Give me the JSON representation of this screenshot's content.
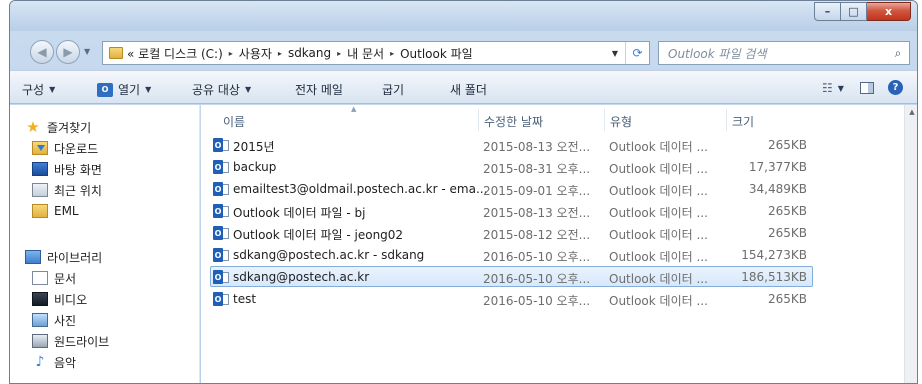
{
  "window": {
    "caption": {
      "min": "–",
      "max": "□",
      "close": "x"
    }
  },
  "nav": {
    "back_icon": "◀",
    "forward_icon": "▶",
    "history_icon": "▼"
  },
  "address": {
    "crumbs": [
      "« 로컬 디스크 (C:)",
      "사용자",
      "sdkang",
      "내 문서",
      "Outlook 파일"
    ],
    "separator": "▸",
    "dropdown_icon": "▼",
    "refresh_icon": "⟳"
  },
  "search": {
    "placeholder": "Outlook 파일 검색",
    "icon": "⌕"
  },
  "toolbar": {
    "organize": "구성",
    "open": "열기",
    "open_icon_text": "O",
    "share": "공유 대상",
    "email": "전자 메일",
    "burn": "굽기",
    "new_folder": "새 폴더",
    "caret": "▼",
    "view_icon": "☷",
    "help": "?"
  },
  "sidebar": {
    "favorites": {
      "label": "즐겨찾기",
      "items": [
        {
          "label": "다운로드",
          "icon": "downloads-folder-icon"
        },
        {
          "label": "바탕 화면",
          "icon": "desktop-icon"
        },
        {
          "label": "최근 위치",
          "icon": "recent-places-icon"
        },
        {
          "label": "EML",
          "icon": "folder-icon"
        }
      ]
    },
    "libraries": {
      "label": "라이브러리",
      "items": [
        {
          "label": "문서",
          "icon": "documents-icon"
        },
        {
          "label": "비디오",
          "icon": "videos-icon"
        },
        {
          "label": "사진",
          "icon": "pictures-icon"
        },
        {
          "label": "원드라이브",
          "icon": "onedrive-icon"
        },
        {
          "label": "음악",
          "icon": "music-icon"
        }
      ]
    }
  },
  "columns": {
    "name": "이름",
    "modified": "수정한 날짜",
    "type": "유형",
    "size": "크기",
    "sort_indicator": "▲"
  },
  "files": [
    {
      "name": "2015년",
      "modified": "2015-08-13 오전...",
      "type": "Outlook 데이터 ...",
      "size": "265KB",
      "selected": false
    },
    {
      "name": "backup",
      "modified": "2015-08-31 오후...",
      "type": "Outlook 데이터 ...",
      "size": "17,377KB",
      "selected": false
    },
    {
      "name": "emailtest3@oldmail.postech.ac.kr - ema...",
      "modified": "2015-09-01 오후...",
      "type": "Outlook 데이터 ...",
      "size": "34,489KB",
      "selected": false
    },
    {
      "name": "Outlook 데이터 파일 - bj",
      "modified": "2015-08-13 오전...",
      "type": "Outlook 데이터 ...",
      "size": "265KB",
      "selected": false
    },
    {
      "name": "Outlook 데이터 파일 - jeong02",
      "modified": "2015-08-12 오전...",
      "type": "Outlook 데이터 ...",
      "size": "265KB",
      "selected": false
    },
    {
      "name": "sdkang@postech.ac.kr - sdkang",
      "modified": "2016-05-10 오후...",
      "type": "Outlook 데이터 ...",
      "size": "154,273KB",
      "selected": false
    },
    {
      "name": "sdkang@postech.ac.kr",
      "modified": "2016-05-10 오후...",
      "type": "Outlook 데이터 ...",
      "size": "186,513KB",
      "selected": true
    },
    {
      "name": "test",
      "modified": "2016-05-10 오후...",
      "type": "Outlook 데이터 ...",
      "size": "265KB",
      "selected": false
    }
  ],
  "file_icon_text": "O",
  "scrollbar": {
    "up_icon": "▲"
  },
  "colors": {
    "selection_bg": "#d7e8fb",
    "selection_border": "#84acdd",
    "accent": "#1f5fb8"
  }
}
